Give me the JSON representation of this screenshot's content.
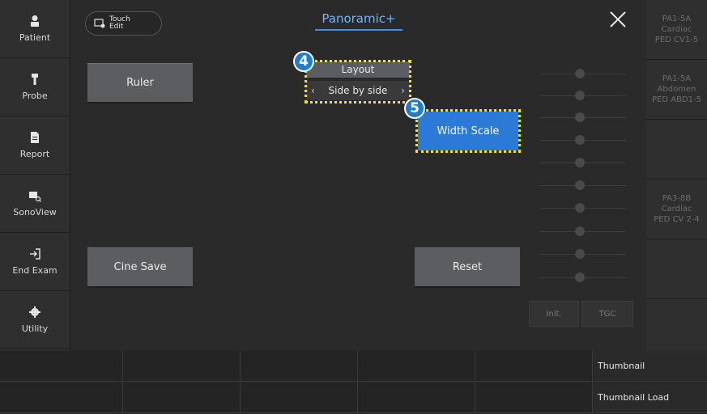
{
  "sidebar": {
    "items": [
      {
        "label": "Patient",
        "icon": "patient-icon"
      },
      {
        "label": "Probe",
        "icon": "probe-icon"
      },
      {
        "label": "Report",
        "icon": "report-icon"
      },
      {
        "label": "SonoView",
        "icon": "sonoview-icon"
      },
      {
        "label": "End Exam",
        "icon": "end-exam-icon"
      },
      {
        "label": "Utility",
        "icon": "gear-icon"
      }
    ]
  },
  "header": {
    "touch_edit_line1": "Touch",
    "touch_edit_line2": "Edit",
    "title": "Panoramic+",
    "close_icon": "close-icon"
  },
  "buttons": {
    "ruler": "Ruler",
    "cine_save": "Cine Save",
    "reset": "Reset",
    "width_scale": "Width Scale"
  },
  "layout_control": {
    "title": "Layout",
    "value": "Side by side",
    "prev": "‹",
    "next": "›"
  },
  "callouts": {
    "four": "4",
    "five": "5"
  },
  "tgc": {
    "init": "Init.",
    "tgc": "TGC"
  },
  "probes": [
    {
      "model": "PA1-5A",
      "app": "Cardiac",
      "preset": "PED CV1-5"
    },
    {
      "model": "PA1-5A",
      "app": "Abdomen",
      "preset": "PED ABD1-5"
    },
    {
      "model": "",
      "app": "",
      "preset": ""
    },
    {
      "model": "PA3-8B",
      "app": "Cardiac",
      "preset": "PED CV 2-4"
    },
    {
      "model": "",
      "app": "",
      "preset": ""
    },
    {
      "model": "",
      "app": "",
      "preset": ""
    }
  ],
  "bottom": {
    "thumbnail": "Thumbnail",
    "thumbnail_load": "Thumbnail Load"
  },
  "colors": {
    "accent": "#2a7ad6",
    "title": "#6fb6ff",
    "highlight": "#f6e21b"
  }
}
